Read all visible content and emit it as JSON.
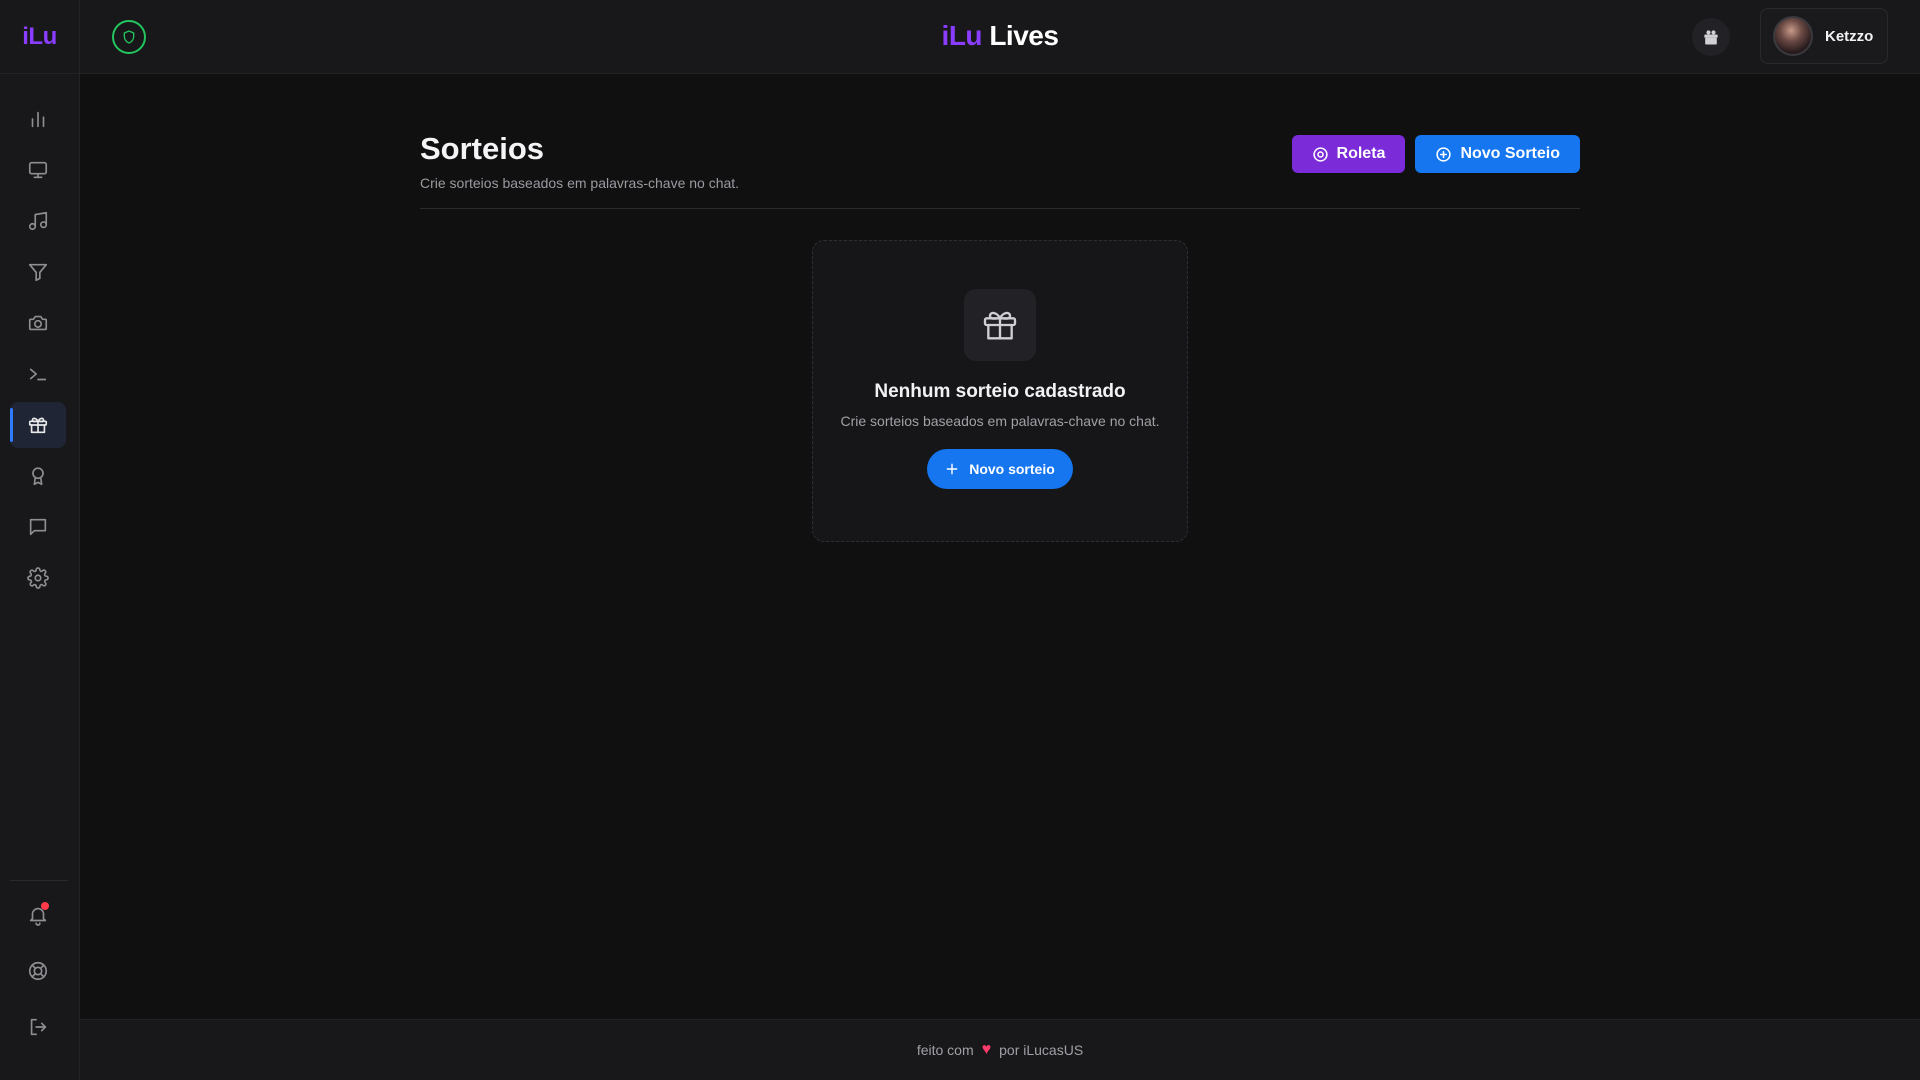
{
  "brand": {
    "sidebar_logo": "iLu",
    "top_logo_prefix": "iLu",
    "top_logo_suffix": "Lives"
  },
  "user": {
    "name": "Ketzzo"
  },
  "sidebar": {
    "items": [
      {
        "icon": "bar-chart-icon",
        "active": false
      },
      {
        "icon": "monitor-icon",
        "active": false
      },
      {
        "icon": "music-icon",
        "active": false
      },
      {
        "icon": "filter-icon",
        "active": false
      },
      {
        "icon": "camera-icon",
        "active": false
      },
      {
        "icon": "terminal-icon",
        "active": false
      },
      {
        "icon": "gift-icon",
        "active": true
      },
      {
        "icon": "award-icon",
        "active": false
      },
      {
        "icon": "message-icon",
        "active": false
      },
      {
        "icon": "gear-icon",
        "active": false
      }
    ],
    "bottom_items": [
      {
        "icon": "bell-icon",
        "has_notification": true
      },
      {
        "icon": "lifebuoy-icon"
      },
      {
        "icon": "logout-icon"
      }
    ]
  },
  "page": {
    "title": "Sorteios",
    "subtitle": "Crie sorteios baseados em palavras-chave no chat.",
    "actions": {
      "roulette_label": "Roleta",
      "new_label": "Novo Sorteio"
    }
  },
  "empty_state": {
    "title": "Nenhum sorteio cadastrado",
    "subtitle": "Crie sorteios baseados em palavras-chave no chat.",
    "button_label": "Novo sorteio"
  },
  "footer": {
    "prefix": "feito com",
    "suffix": "por iLucasUS"
  },
  "colors": {
    "accent_purple": "#7c2bd9",
    "accent_blue": "#1576f0",
    "shield_green": "#22c55e"
  }
}
